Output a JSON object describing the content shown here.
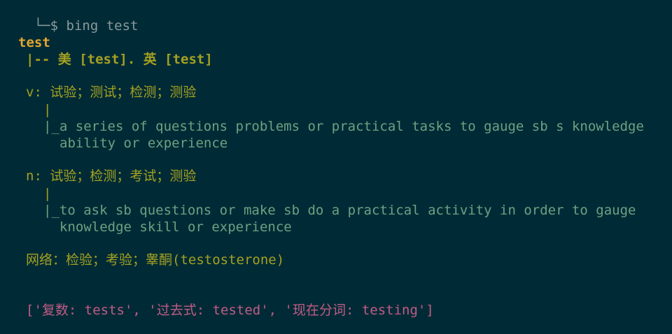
{
  "prompt": {
    "prefix": "└─$ ",
    "command": "bing test"
  },
  "entry": {
    "word": "test",
    "phonetic": "|-- 美 [test]. 英 [test]"
  },
  "senses": [
    {
      "pos_line": "v: 试验；测试；检测；测验",
      "tree_bar": "|",
      "definition_first": "|_a series of questions problems or practical tasks to gauge sb s knowledge",
      "definition_cont": "ability or experience"
    },
    {
      "pos_line": "n: 试验；检测；考试；测验",
      "tree_bar": "|",
      "definition_first": "|_to ask sb questions or make sb do a practical activity in order to gauge",
      "definition_cont": "knowledge skill or experience"
    }
  ],
  "web": {
    "line": "网络：检验；考验；睾酮(testosterone)"
  },
  "forms": {
    "line": "['复数: tests', '过去式: tested', '现在分词: testing']"
  },
  "colors": {
    "background": "#002b36",
    "headword": "#e3a62f",
    "chinese": "#a5a021",
    "definition": "#6fa082",
    "forms": "#c25b86",
    "prompt": "#8a9a9c"
  }
}
